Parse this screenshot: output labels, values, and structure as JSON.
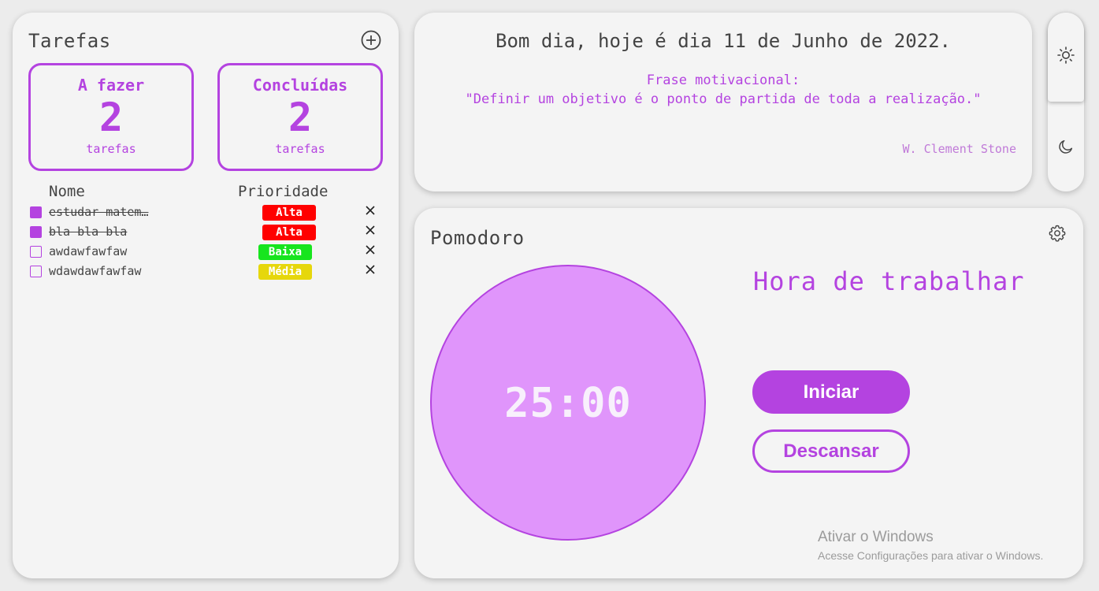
{
  "tasks": {
    "title": "Tarefas",
    "todo": {
      "label": "A fazer",
      "count": "2",
      "unit": "tarefas"
    },
    "done": {
      "label": "Concluídas",
      "count": "2",
      "unit": "tarefas"
    },
    "headers": {
      "name": "Nome",
      "priority": "Prioridade"
    },
    "items": [
      {
        "name": "estudar matem…",
        "priority": "Alta",
        "priority_color": "#ff0000",
        "checked": true
      },
      {
        "name": "bla bla bla",
        "priority": "Alta",
        "priority_color": "#ff0000",
        "checked": true
      },
      {
        "name": "awdawfawfaw",
        "priority": "Baixa",
        "priority_color": "#17e51e",
        "checked": false
      },
      {
        "name": "wdawdawfawfaw",
        "priority": "Média",
        "priority_color": "#e6d70c",
        "checked": false
      }
    ],
    "add_icon": "plus-circle-icon",
    "delete_icon": "close-icon"
  },
  "greeting": {
    "text": "Bom dia, hoje é dia 11 de Junho de 2022.",
    "quote_heading": "Frase motivacional:",
    "quote": "\"Definir um objetivo é o ponto de partida de toda a realização.\"",
    "author": "W. Clement Stone"
  },
  "theme": {
    "light_icon": "sun-icon",
    "dark_icon": "moon-icon",
    "active": "light"
  },
  "pomodoro": {
    "title": "Pomodoro",
    "timer": "25:00",
    "mode": "Hora de trabalhar",
    "start_label": "Iniciar",
    "rest_label": "Descansar",
    "settings_icon": "gear-icon"
  },
  "watermark": {
    "title": "Ativar o Windows",
    "subtitle": "Acesse Configurações para ativar o Windows."
  },
  "colors": {
    "accent": "#b443e0",
    "timer_fill": "#e095fb",
    "card_bg": "#f4f4f4",
    "page_bg": "#ececec"
  }
}
